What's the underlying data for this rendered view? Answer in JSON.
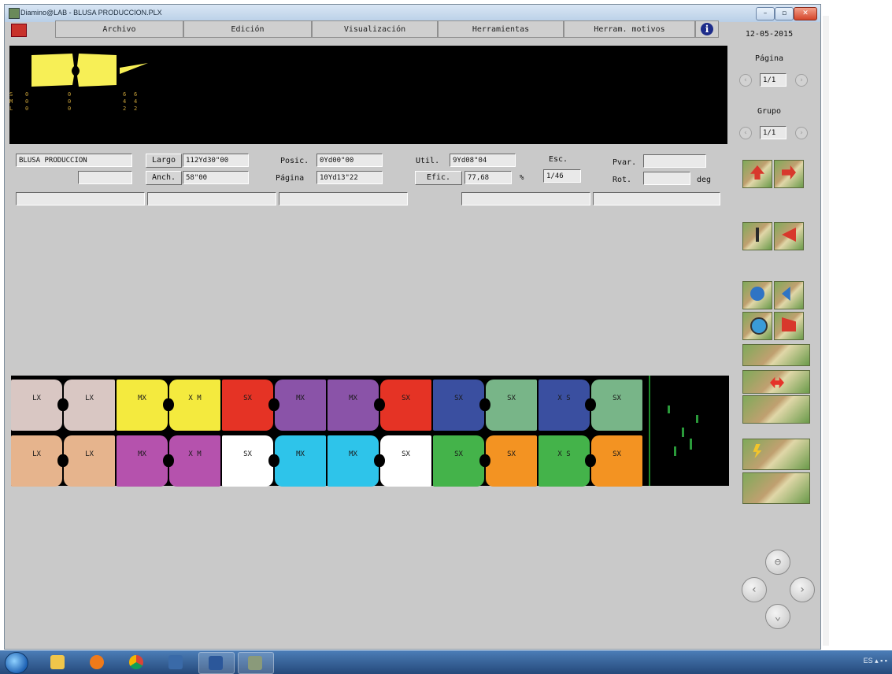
{
  "window": {
    "title": "Diamino@LAB - BLUSA PRODUCCION.PLX"
  },
  "menu": [
    "Archivo",
    "Edición",
    "Visualización",
    "Herramientas",
    "Herram. motivos"
  ],
  "date": "12-05-2015",
  "page_group": {
    "page_label": "Página",
    "page_value": "1/1",
    "group_label": "Grupo",
    "group_value": "1/1"
  },
  "preview": {
    "size_rows": [
      {
        "size": "S",
        "c1": "0",
        "c2": "0",
        "c3": "6",
        "c4": "6"
      },
      {
        "size": "M",
        "c1": "0",
        "c2": "0",
        "c3": "4",
        "c4": "4"
      },
      {
        "size": "L",
        "c1": "0",
        "c2": "0",
        "c3": "2",
        "c4": "2"
      }
    ],
    "colors": {
      "piece": "#f7ef56"
    }
  },
  "info": {
    "name": "BLUSA PRODUCCION",
    "largo_label": "Largo",
    "largo_value": "112Yd30\"00",
    "anch_label": "Anch.",
    "anch_value": "58\"00",
    "posic_label": "Posic.",
    "posic_value": "0Yd00\"00",
    "pagina_label": "Página",
    "pagina_value": "10Yd13\"22",
    "util_label": "Util.",
    "util_value": "9Yd08\"04",
    "efic_label": "Efic.",
    "efic_value": "77,68",
    "efic_unit": "%",
    "esc_label": "Esc.",
    "esc_value": "1/46",
    "pvar_label": "Pvar.",
    "pvar_value": "",
    "rot_label": "Rot.",
    "rot_value": "",
    "rot_unit": "deg"
  },
  "marker": {
    "top_row": [
      {
        "label": "LX",
        "color": "#d9c7c3"
      },
      {
        "label": "LX",
        "color": "#d9c7c3"
      },
      {
        "label": "MX",
        "color": "#f4ea3e"
      },
      {
        "label": "X M",
        "color": "#f4ea3e"
      },
      {
        "label": "SX",
        "color": "#e53325"
      },
      {
        "label": "MX",
        "color": "#8a53a8"
      },
      {
        "label": "MX",
        "color": "#8a53a8"
      },
      {
        "label": "SX",
        "color": "#e53325"
      },
      {
        "label": "SX",
        "color": "#3a4fa0"
      },
      {
        "label": "SX",
        "color": "#78b588"
      },
      {
        "label": "X S",
        "color": "#3a4fa0"
      },
      {
        "label": "SX",
        "color": "#78b588"
      }
    ],
    "bottom_row": [
      {
        "label": "LX",
        "color": "#e6b48d"
      },
      {
        "label": "LX",
        "color": "#e6b48d"
      },
      {
        "label": "MX",
        "color": "#b552ad"
      },
      {
        "label": "X M",
        "color": "#b552ad"
      },
      {
        "label": "SX",
        "color": "#ffffff"
      },
      {
        "label": "MX",
        "color": "#2ec4ea"
      },
      {
        "label": "MX",
        "color": "#2ec4ea"
      },
      {
        "label": "SX",
        "color": "#ffffff"
      },
      {
        "label": "SX",
        "color": "#44b34a"
      },
      {
        "label": "SX",
        "color": "#f39322"
      },
      {
        "label": "X S",
        "color": "#44b34a"
      },
      {
        "label": "SX",
        "color": "#f39322"
      }
    ]
  },
  "tray": {
    "lang": "ES"
  }
}
